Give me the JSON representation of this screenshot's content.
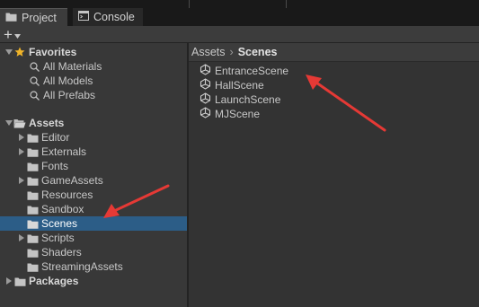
{
  "tabs": [
    {
      "label": "Project",
      "icon": "folder-icon"
    },
    {
      "label": "Console",
      "icon": "console-icon"
    }
  ],
  "toolbar": {
    "add_label": "+",
    "add_menu_icon": "caret-down-icon"
  },
  "favorites": {
    "label": "Favorites",
    "items": [
      "All Materials",
      "All Models",
      "All Prefabs"
    ]
  },
  "assets": {
    "label": "Assets",
    "items": [
      {
        "label": "Editor",
        "expandable": true
      },
      {
        "label": "Externals",
        "expandable": true
      },
      {
        "label": "Fonts",
        "expandable": false
      },
      {
        "label": "GameAssets",
        "expandable": true
      },
      {
        "label": "Resources",
        "expandable": false
      },
      {
        "label": "Sandbox",
        "expandable": false
      },
      {
        "label": "Scenes",
        "expandable": false,
        "selected": true
      },
      {
        "label": "Scripts",
        "expandable": true
      },
      {
        "label": "Shaders",
        "expandable": false
      },
      {
        "label": "StreamingAssets",
        "expandable": false
      }
    ]
  },
  "packages": {
    "label": "Packages"
  },
  "breadcrumb": {
    "root": "Assets",
    "separator": "›",
    "current": "Scenes"
  },
  "scenes": [
    "EntranceScene",
    "HallScene",
    "LaunchScene",
    "MJScene"
  ],
  "colors": {
    "selection": "#2c5d87",
    "annotation_arrow": "#e53935",
    "star": "#f0b429"
  }
}
